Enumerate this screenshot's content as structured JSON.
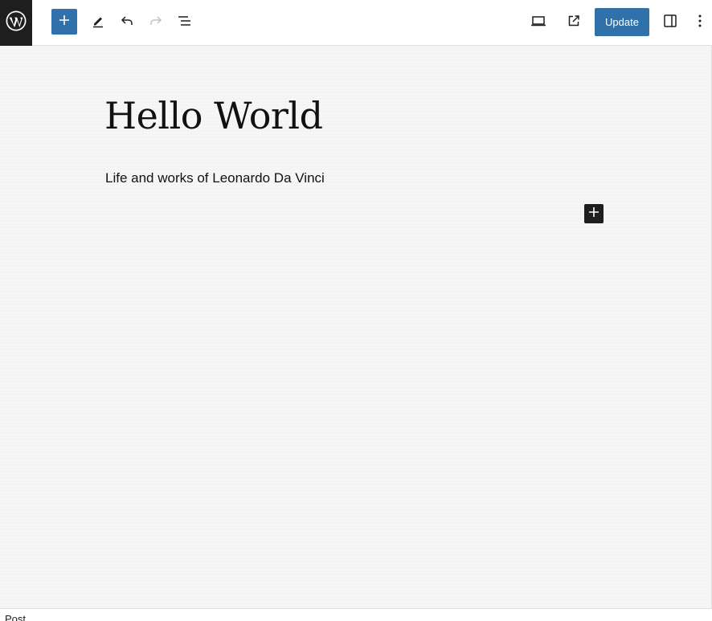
{
  "toolbar": {
    "logo_icon": "wordpress-icon",
    "inserter_icon": "plus-icon",
    "tools_icon": "pencil-icon",
    "undo_icon": "undo-icon",
    "redo_icon": "redo-icon",
    "list_view_icon": "list-view-icon",
    "preview_icon": "laptop-icon",
    "view_post_icon": "external-link-icon",
    "update_label": "Update",
    "settings_icon": "sidebar-toggle-icon",
    "options_icon": "more-vertical-icon"
  },
  "editor": {
    "title": "Hello World",
    "paragraph": "Life and works of Leonardo Da Vinci",
    "block_inserter_icon": "plus-icon"
  },
  "footer": {
    "breadcrumb": "Post"
  },
  "colors": {
    "accent": "#3071a9",
    "dark": "#1e1e1e",
    "disabled": "#c2c2c2",
    "canvas": "#f6f6f6"
  }
}
